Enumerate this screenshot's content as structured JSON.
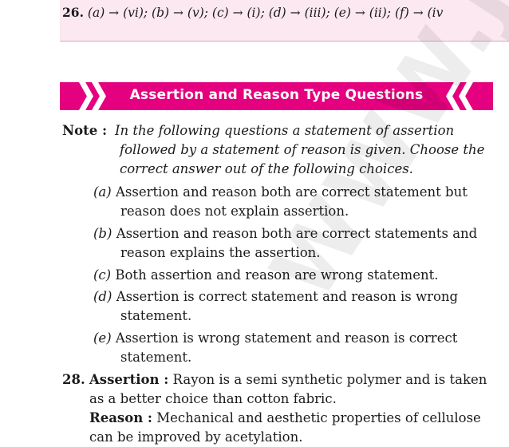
{
  "answer_line": {
    "number": "26.",
    "text": "(a) → (vi); (b) → (v); (c) → (i); (d) → (iii); (e) → (ii); (f) → (iv"
  },
  "banner": {
    "title": "Assertion and Reason Type Questions"
  },
  "note": {
    "label": "Note :",
    "lines": [
      "In the following questions a statement of   assertion",
      "followed by a statement of reason is given. Choose the",
      "correct answer out of the following choices."
    ]
  },
  "choices": [
    {
      "label": "(a)",
      "lines": [
        "Assertion and reason both are correct statement but",
        "reason does not explain assertion."
      ]
    },
    {
      "label": "(b)",
      "lines": [
        " Assertion and reason both are correct statements and",
        "reason explains the assertion."
      ]
    },
    {
      "label": "(c)",
      "lines": [
        "Both assertion and reason are wrong statement."
      ]
    },
    {
      "label": "(d)",
      "lines": [
        "Assertion is correct statement and reason is wrong",
        "statement."
      ]
    },
    {
      "label": "(e)",
      "lines": [
        "Assertion is wrong statement and reason is correct",
        "statement."
      ]
    }
  ],
  "q28": {
    "number": "28.",
    "assertion_label": "Assertion :",
    "assertion_lines": [
      " Rayon is a semi synthetic polymer and is taken",
      "as a better choice than cotton fabric."
    ],
    "reason_label": "Reason :",
    "reason_text": " Mechanical and aesthetic properties of cellulose",
    "reason_partial": "can be improved by acetylation."
  },
  "watermark": {
    "text": "WWW.JEE"
  },
  "colors": {
    "accent": "#e4007e",
    "band": "#fbe8f1"
  }
}
